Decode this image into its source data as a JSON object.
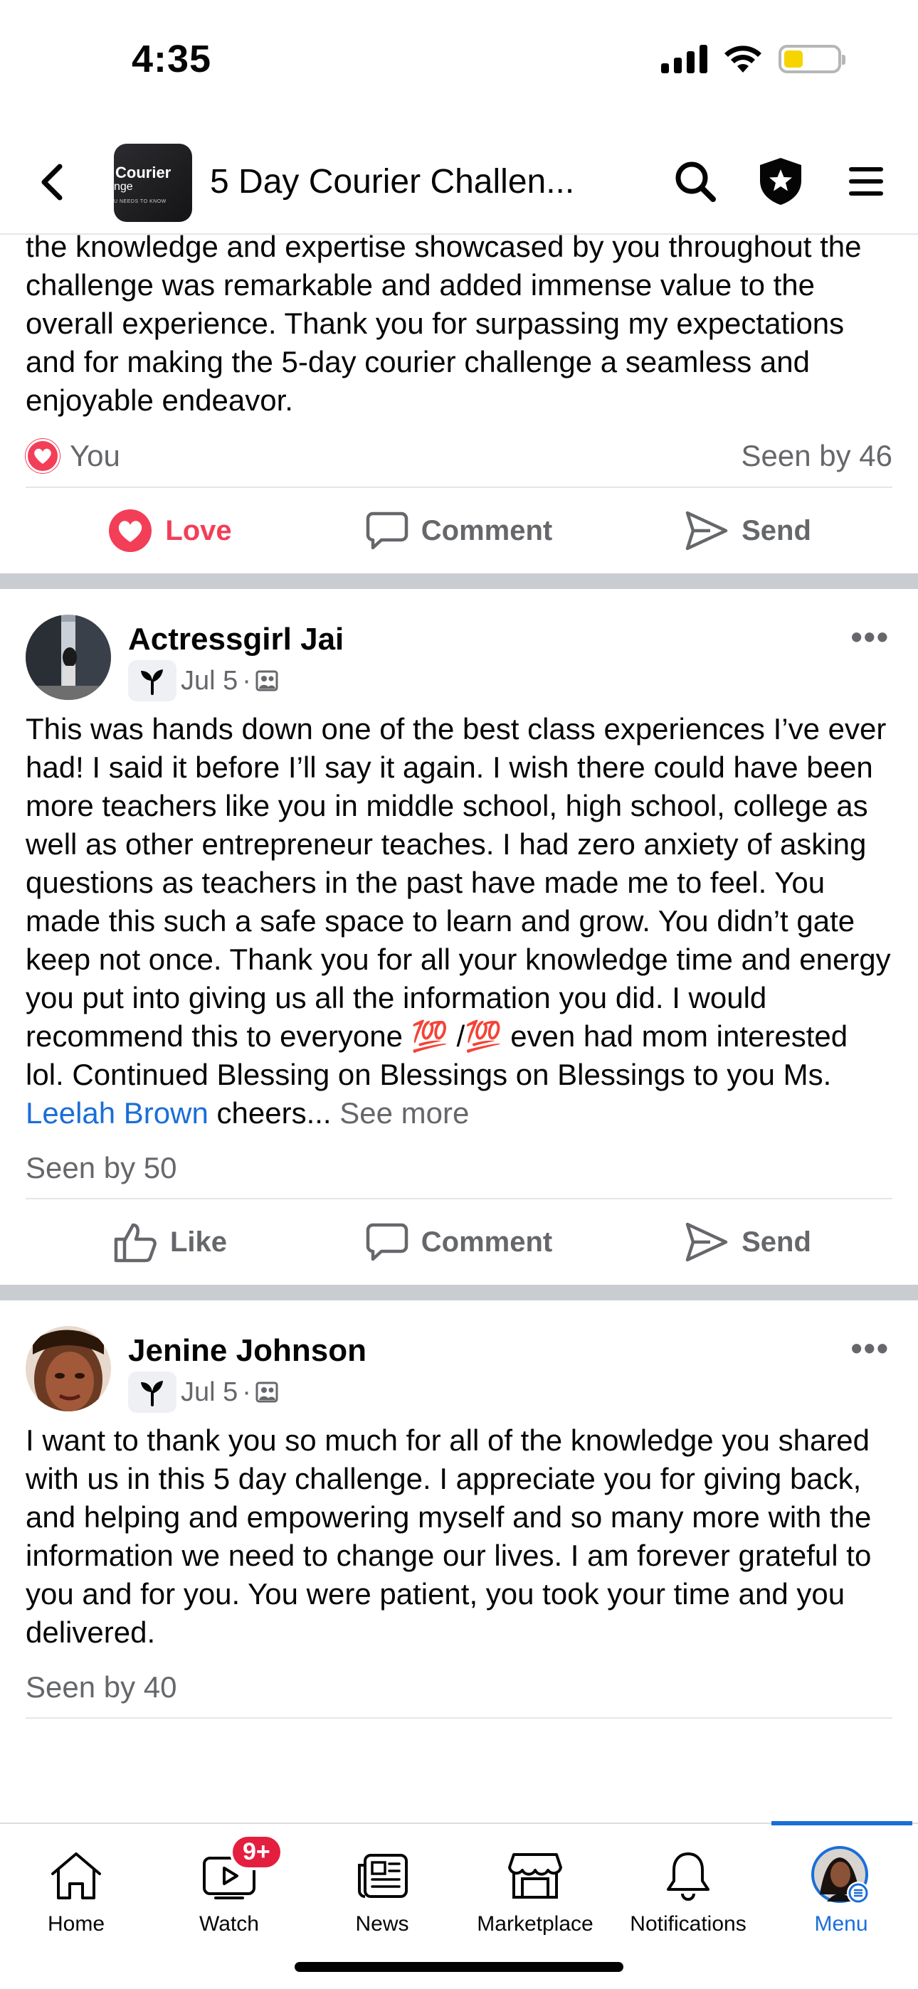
{
  "status_bar": {
    "time": "4:35"
  },
  "header": {
    "title": "5 Day Courier Challen...",
    "avatar_text": {
      "line1": "Courier",
      "line2": "nge",
      "line3": "U NEEDS TO KNOW"
    }
  },
  "post1": {
    "text": "the knowledge and expertise showcased by you throughout the challenge was remarkable and added immense value to the overall experience. Thank you for surpassing my expectations and for making the 5-day courier challenge a seamless and enjoyable endeavor.",
    "reactor": "You",
    "seen": "Seen by 46",
    "actions": {
      "react": "Love",
      "comment": "Comment",
      "send": "Send"
    }
  },
  "post2": {
    "author": "Actressgirl Jai",
    "date": "Jul 5",
    "dot": "·",
    "more": "•••",
    "text_main": "This was hands down one of the best class experiences I’ve ever had! I said it before I’ll say it again. I wish there could have been more teachers like you in middle school, high school, college as well as other entrepreneur teaches. I had zero anxiety of asking questions as teachers in the past have made me to feel. You made this such a safe space to learn and grow. You didn’t gate keep not once. Thank you for all your knowledge time and energy you put into giving us all the information you did. I would recommend this to everyone 💯 /💯 even had mom interested lol. Continued Blessing on Blessings on Blessings to you Ms. ",
    "mention": "Leelah Brown",
    "text_after": " cheers... ",
    "see_more": "See more",
    "seen": "Seen by 50",
    "actions": {
      "like": "Like",
      "comment": "Comment",
      "send": "Send"
    }
  },
  "post3": {
    "author": "Jenine Johnson",
    "date": "Jul 5",
    "dot": "·",
    "more": "•••",
    "text": "I want to thank you so much for all of the knowledge you shared with us in this 5 day challenge. I appreciate you for giving back, and helping and empowering myself and so many more with the information we need to change our lives. I am forever grateful to you and for you. You were patient, you took your time and you delivered.",
    "seen": "Seen by 40"
  },
  "bottom_nav": {
    "items": [
      {
        "label": "Home",
        "icon": "home-icon"
      },
      {
        "label": "Watch",
        "icon": "watch-icon",
        "badge": "9+"
      },
      {
        "label": "News",
        "icon": "news-icon"
      },
      {
        "label": "Marketplace",
        "icon": "marketplace-icon"
      },
      {
        "label": "Notifications",
        "icon": "bell-icon"
      },
      {
        "label": "Menu",
        "icon": "profile-avatar",
        "active": true
      }
    ]
  },
  "colors": {
    "love": "#f33e58",
    "link": "#1a6ed8",
    "muted": "#65676b",
    "badge": "#e41e3f"
  }
}
